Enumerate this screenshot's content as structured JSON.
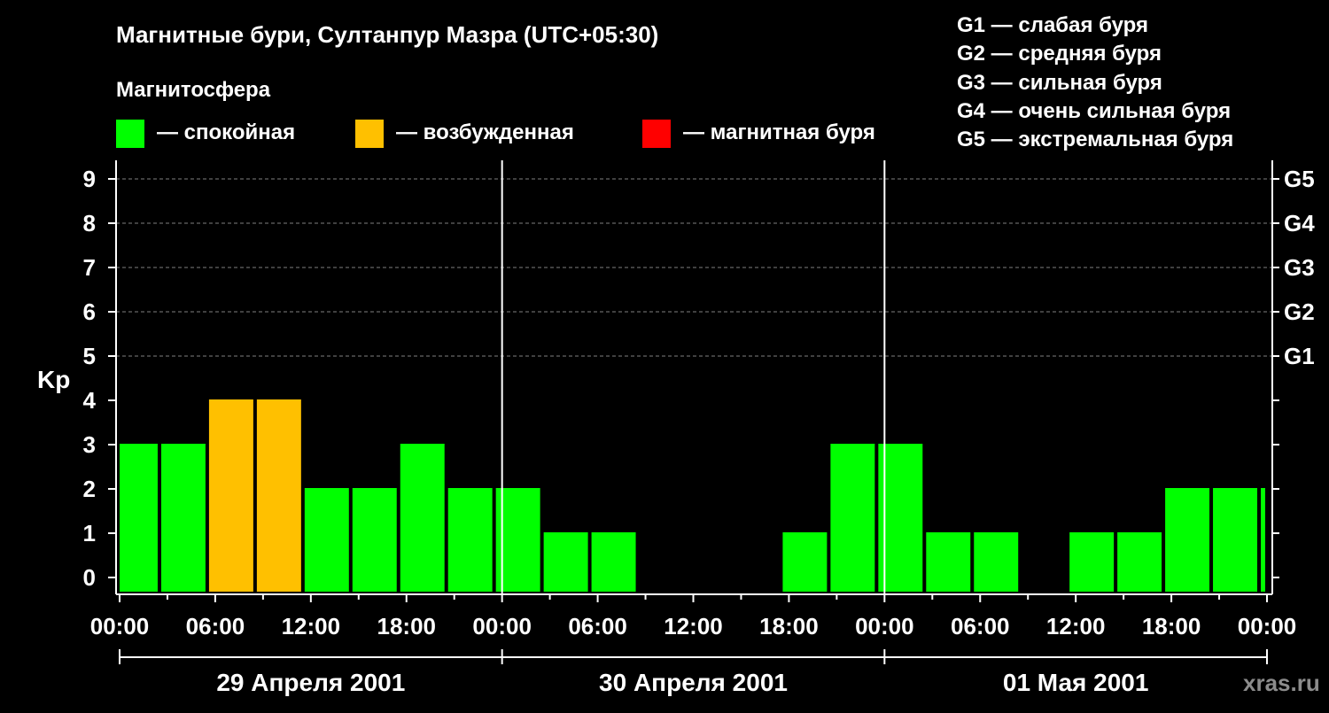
{
  "chart_data": {
    "type": "bar",
    "title": "Магнитные бури, Султанпур Мазра (UTC+05:30)",
    "legend_title": "Магнитосфера",
    "legend": [
      {
        "name": "— спокойная",
        "color": "#00ff00"
      },
      {
        "name": "— возбужденная",
        "color": "#ffc000"
      },
      {
        "name": "— магнитная буря",
        "color": "#ff0000"
      }
    ],
    "g_scale_legend": [
      "G1 — слабая буря",
      "G2 — средняя буря",
      "G3 — сильная буря",
      "G4 — очень сильная буря",
      "G5 — экстремальная буря"
    ],
    "ylabel": "Kp",
    "ylim": [
      0,
      9
    ],
    "yticks": [
      "0",
      "1",
      "2",
      "3",
      "4",
      "5",
      "6",
      "7",
      "8",
      "9"
    ],
    "right_ticks": [
      {
        "kp": 5,
        "label": "G1"
      },
      {
        "kp": 6,
        "label": "G2"
      },
      {
        "kp": 7,
        "label": "G3"
      },
      {
        "kp": 8,
        "label": "G4"
      },
      {
        "kp": 9,
        "label": "G5"
      }
    ],
    "xtick_labels": [
      "00:00",
      "06:00",
      "12:00",
      "18:00",
      "00:00",
      "06:00",
      "12:00",
      "18:00",
      "00:00",
      "06:00",
      "12:00",
      "18:00",
      "00:00"
    ],
    "xtick_hours": [
      0,
      6,
      12,
      18,
      24,
      30,
      36,
      42,
      48,
      54,
      60,
      66,
      72
    ],
    "day_boundaries_hours": [
      24,
      48
    ],
    "days": [
      {
        "label": "29 Апреля 2001",
        "from_hour": 0,
        "to_hour": 24
      },
      {
        "label": "30 Апреля 2001",
        "from_hour": 24,
        "to_hour": 48
      },
      {
        "label": "01 Мая 2001",
        "from_hour": 48,
        "to_hour": 72
      }
    ],
    "grid": true,
    "bars": [
      {
        "start_hour": -0.5,
        "end_hour": 2.5,
        "kp": 3,
        "state": "calm"
      },
      {
        "start_hour": 2.5,
        "end_hour": 5.5,
        "kp": 3,
        "state": "calm"
      },
      {
        "start_hour": 5.5,
        "end_hour": 8.5,
        "kp": 4,
        "state": "excited"
      },
      {
        "start_hour": 8.5,
        "end_hour": 11.5,
        "kp": 4,
        "state": "excited"
      },
      {
        "start_hour": 11.5,
        "end_hour": 14.5,
        "kp": 2,
        "state": "calm"
      },
      {
        "start_hour": 14.5,
        "end_hour": 17.5,
        "kp": 2,
        "state": "calm"
      },
      {
        "start_hour": 17.5,
        "end_hour": 20.5,
        "kp": 3,
        "state": "calm"
      },
      {
        "start_hour": 20.5,
        "end_hour": 23.5,
        "kp": 2,
        "state": "calm"
      },
      {
        "start_hour": 23.5,
        "end_hour": 26.5,
        "kp": 2,
        "state": "calm"
      },
      {
        "start_hour": 26.5,
        "end_hour": 29.5,
        "kp": 1,
        "state": "calm"
      },
      {
        "start_hour": 29.5,
        "end_hour": 32.5,
        "kp": 1,
        "state": "calm"
      },
      {
        "start_hour": 32.5,
        "end_hour": 35.5,
        "kp": 0,
        "state": "calm"
      },
      {
        "start_hour": 35.5,
        "end_hour": 38.5,
        "kp": 0,
        "state": "calm"
      },
      {
        "start_hour": 38.5,
        "end_hour": 41.5,
        "kp": 0,
        "state": "calm"
      },
      {
        "start_hour": 41.5,
        "end_hour": 44.5,
        "kp": 1,
        "state": "calm"
      },
      {
        "start_hour": 44.5,
        "end_hour": 47.5,
        "kp": 3,
        "state": "calm"
      },
      {
        "start_hour": 47.5,
        "end_hour": 50.5,
        "kp": 3,
        "state": "calm"
      },
      {
        "start_hour": 50.5,
        "end_hour": 53.5,
        "kp": 1,
        "state": "calm"
      },
      {
        "start_hour": 53.5,
        "end_hour": 56.5,
        "kp": 1,
        "state": "calm"
      },
      {
        "start_hour": 56.5,
        "end_hour": 59.5,
        "kp": 0,
        "state": "calm"
      },
      {
        "start_hour": 59.5,
        "end_hour": 62.5,
        "kp": 1,
        "state": "calm"
      },
      {
        "start_hour": 62.5,
        "end_hour": 65.5,
        "kp": 1,
        "state": "calm"
      },
      {
        "start_hour": 65.5,
        "end_hour": 68.5,
        "kp": 2,
        "state": "calm"
      },
      {
        "start_hour": 68.5,
        "end_hour": 71.5,
        "kp": 2,
        "state": "calm"
      },
      {
        "start_hour": 71.5,
        "end_hour": 72.5,
        "kp": 2,
        "state": "calm"
      }
    ],
    "state_colors": {
      "calm": "#00ff00",
      "excited": "#ffc000",
      "storm": "#ff0000"
    }
  },
  "watermark": "xras.ru"
}
